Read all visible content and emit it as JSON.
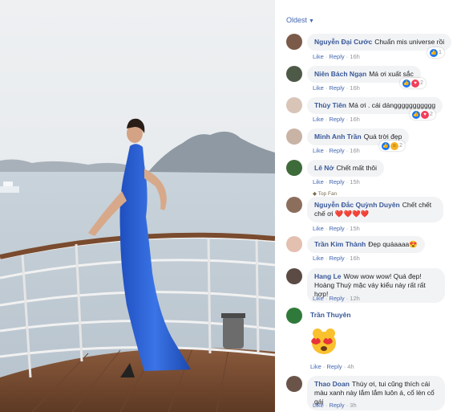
{
  "sort": {
    "label": "Oldest"
  },
  "meta_labels": {
    "like": "Like",
    "reply": "Reply",
    "sep": " · "
  },
  "badges": {
    "top_fan": "Top Fan"
  },
  "comments": [
    {
      "author": "Nguyễn Đại Cước",
      "text": "Chuẩn mis universe rồi",
      "time": "16h",
      "react_count": "1",
      "reactions": [
        "like"
      ]
    },
    {
      "author": "Niên Bách Ngạn",
      "text": "Má ơi xuất sắc",
      "time": "16h",
      "react_count": "2",
      "reactions": [
        "like",
        "love"
      ]
    },
    {
      "author": "Thùy Tiên",
      "text": "Má ơi . cái dánggggggggggg",
      "time": "16h",
      "react_count": "2",
      "reactions": [
        "like",
        "love"
      ]
    },
    {
      "author": "Minh Anh Trần",
      "text": "Quá trời đẹp",
      "time": "16h",
      "react_count": "2",
      "reactions": [
        "like",
        "haha"
      ]
    },
    {
      "author": "Lê Nở",
      "text": "Chết mất thôi",
      "time": "15h",
      "react_count": "",
      "reactions": []
    },
    {
      "author": "Nguyễn Đắc Quỳnh Duyên",
      "text": "Chết chết chế ơi ❤️❤️❤️❤️",
      "time": "15h",
      "react_count": "",
      "reactions": []
    },
    {
      "author": "Trần Kim Thành",
      "text": "Đẹp quáaaaa😍",
      "time": "16h",
      "react_count": "",
      "reactions": []
    },
    {
      "author": "Hang Le",
      "text": "Wow wow wow! Quá đẹp! Hoàng Thuỳ mặc váy kiểu này rất rất hợp!",
      "time": "12h",
      "react_count": "",
      "reactions": []
    },
    {
      "author": "Trần Thuyên",
      "text": "",
      "time": "4h",
      "react_count": "",
      "reactions": []
    },
    {
      "author": "Thao Doan",
      "text": "Thùy ơi, tui cũng thích cái màu xanh này lắm lắm luôn á, cổ lèn cổ gái",
      "time": "3h",
      "react_count": "",
      "reactions": []
    }
  ],
  "colors": {
    "link": "#4267b2",
    "author": "#385898",
    "bubble": "#f2f3f5",
    "dress": "#2c63d6"
  }
}
